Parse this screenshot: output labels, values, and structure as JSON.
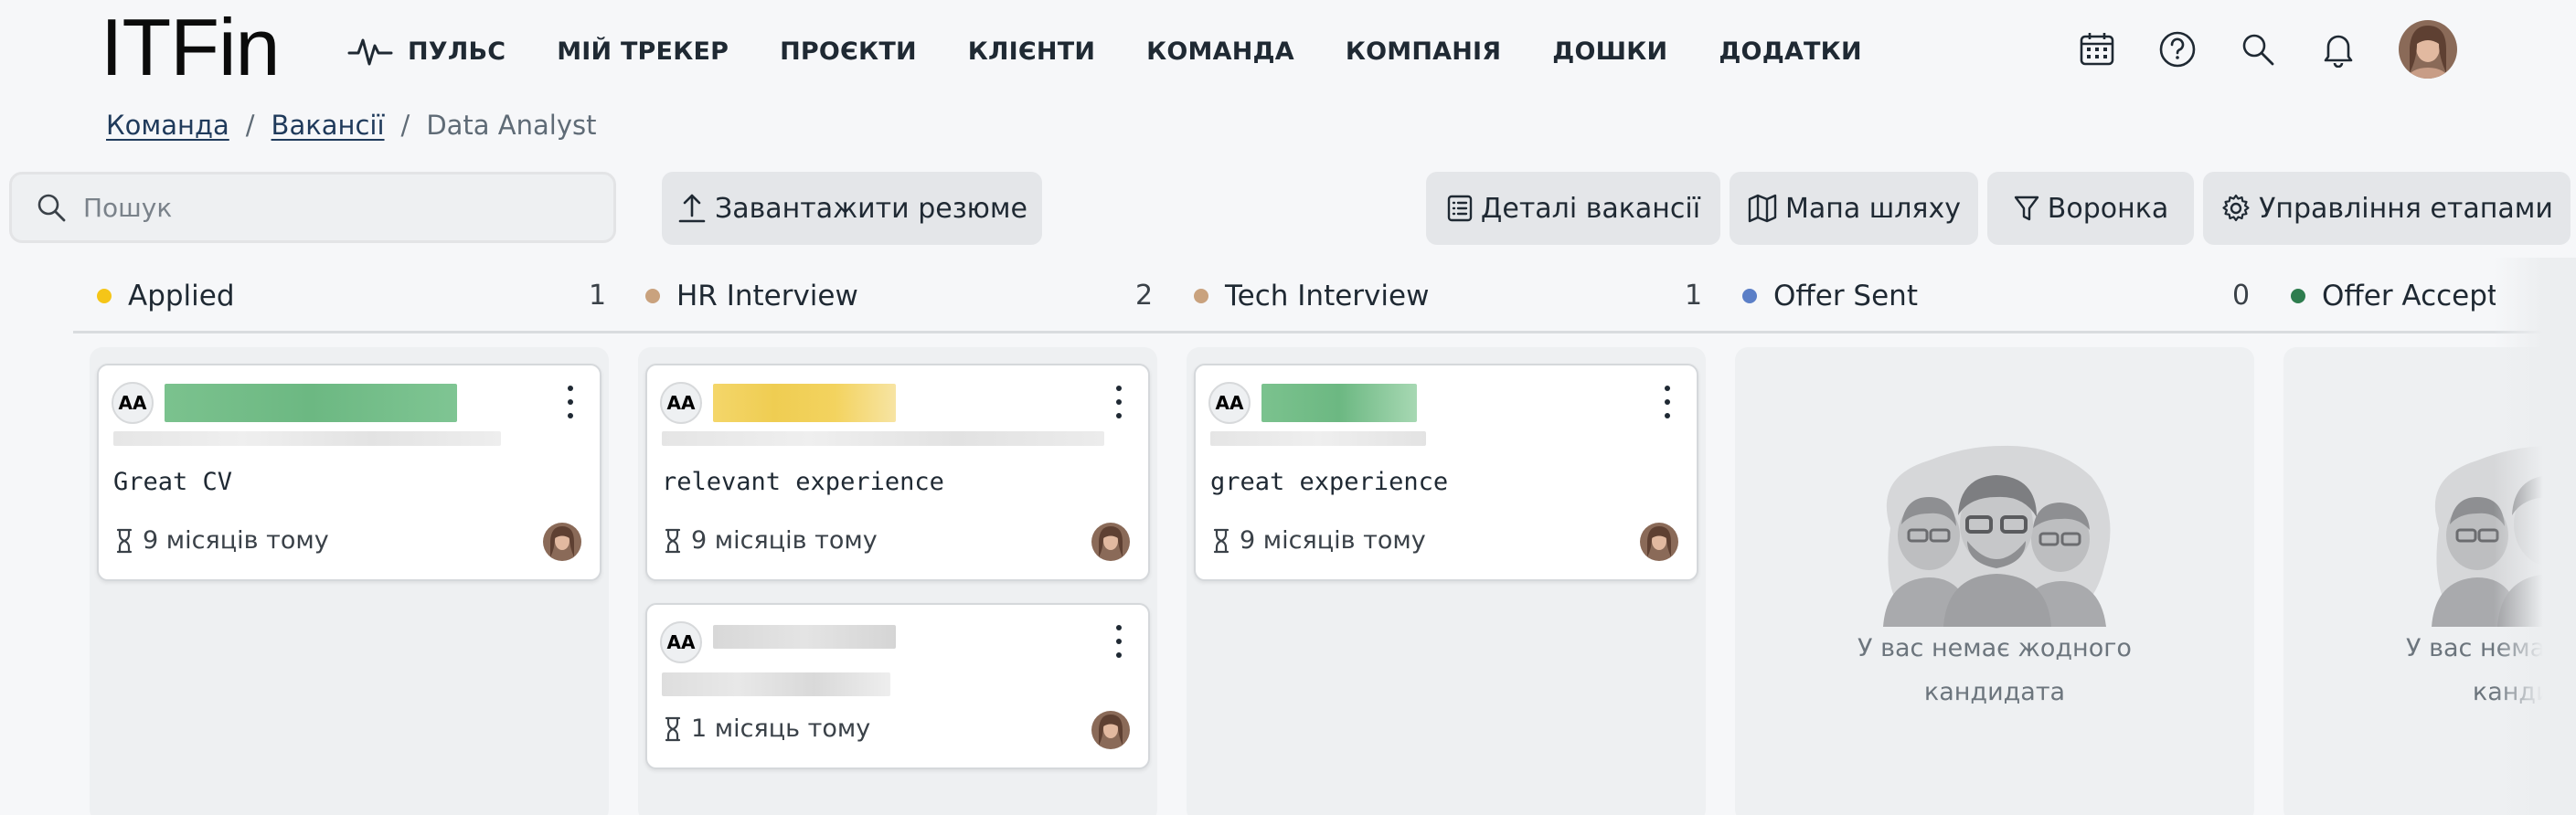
{
  "app": {
    "logo": "ITFin"
  },
  "nav": [
    {
      "label": "ПУЛЬС",
      "icon": "pulse-icon"
    },
    {
      "label": "МІЙ ТРЕКЕР"
    },
    {
      "label": "ПРОЄКТИ"
    },
    {
      "label": "КЛІЄНТИ"
    },
    {
      "label": "КОМАНДА"
    },
    {
      "label": "КОМПАНІЯ"
    },
    {
      "label": "ДОШКИ"
    },
    {
      "label": "ДОДАТКИ"
    }
  ],
  "header_icons": [
    "calendar-icon",
    "help-icon",
    "search-icon",
    "bell-icon"
  ],
  "breadcrumb": {
    "team": "Команда",
    "vacancies": "Вакансії",
    "current": "Data Analyst",
    "sep": "/"
  },
  "search": {
    "placeholder": "Пошук"
  },
  "toolbar": {
    "upload": "Завантажити резюме",
    "details": "Деталі вакансії",
    "roadmap": "Мапа шляху",
    "funnel": "Воронка",
    "stages": "Управління етапами"
  },
  "columns": [
    {
      "title": "Applied",
      "count": "1",
      "color": "#f5c518"
    },
    {
      "title": "HR Interview",
      "count": "2",
      "color": "#c9a27e"
    },
    {
      "title": "Tech Interview",
      "count": "1",
      "color": "#c9a27e"
    },
    {
      "title": "Offer Sent",
      "count": "0",
      "color": "#5b7fc7"
    },
    {
      "title": "Offer Accepted",
      "count": "",
      "color": "#2e7d4f"
    }
  ],
  "cards": {
    "applied": {
      "initials": "AA",
      "note": "Great CV",
      "time": "9 місяців тому"
    },
    "hr1": {
      "initials": "AA",
      "note": "relevant experience",
      "time": "9 місяців тому"
    },
    "hr2": {
      "initials": "AA",
      "time": "1 місяць тому"
    },
    "tech": {
      "initials": "AA",
      "note": "great experience",
      "time": "9 місяців тому"
    }
  },
  "empty": {
    "line1": "У вас немає жодного",
    "line2": "кандидата"
  }
}
